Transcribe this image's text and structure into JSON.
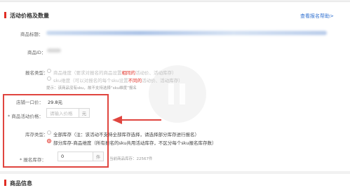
{
  "section1": {
    "title": "活动价格及数量",
    "link": "查看报名帮助>"
  },
  "fields": {
    "product_title_label": "商品标题：",
    "product_id_label": "商品ID：",
    "signup_type_label": "报名类型：",
    "signup_type_options": [
      {
        "prefix": "商品维度（要求对报名的商品设置",
        "emph": "相同的",
        "suffix": "活动价、活动库存）"
      },
      {
        "prefix": "sku维度（可以对报名的每个sku设置",
        "emph": "不同的",
        "suffix": "活动价、活动库存）"
      }
    ],
    "signup_hint": "提示：该商品没有sku，故不支持选择“sku维度”报名",
    "unified_price_label": "店铺一口价：",
    "unified_price_value": "29.8元",
    "activity_price_label": "* 商品活动价格：",
    "activity_price_placeholder": "请输入价格",
    "activity_price_unit": "元",
    "stock_type_label": "库存类型：",
    "stock_options": [
      "全部库存（注：该活动不支持全部库存选择，请选择部分库存进行报名）",
      "部分库存-商品维度（所有报名的sku共用活动库存，不区分每个sku报名库存数）"
    ],
    "signup_stock_label": "* 报名库存：",
    "signup_stock_value": "0",
    "signup_stock_unit": "件",
    "current_stock_text": "当前商品库存：22567件"
  },
  "section2": {
    "title": "商品信息"
  },
  "colors": {
    "accent": "#e02e24",
    "link": "#3070d0",
    "highlight": "#e0453f"
  }
}
